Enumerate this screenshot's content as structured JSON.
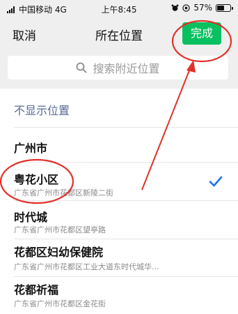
{
  "status_bar": {
    "carrier": "中国移动 4G",
    "time": "上午8:45",
    "battery": "57%",
    "battery_level": 0.57
  },
  "nav": {
    "cancel_label": "取消",
    "title": "所在位置",
    "done_label": "完成"
  },
  "search": {
    "placeholder": "搜索附近位置"
  },
  "list": {
    "hide_location": "不显示位置",
    "city": "广州市",
    "items": [
      {
        "name": "粤花小区",
        "address": "广东省广州市花都区新陵二街",
        "selected": true
      },
      {
        "name": "时代城",
        "address": "广东省广州市花都区望亭路"
      },
      {
        "name": "花都区妇幼保健院",
        "address": "广东省广州市花都区工业大道东时代城华..."
      },
      {
        "name": "花都祈福",
        "address": "广东省广州市花都区金花街"
      }
    ]
  },
  "colors": {
    "accent_green": "#07c160",
    "link_blue": "#576b95",
    "check_blue": "#1a73e8",
    "annotation_red": "#e0302a"
  }
}
